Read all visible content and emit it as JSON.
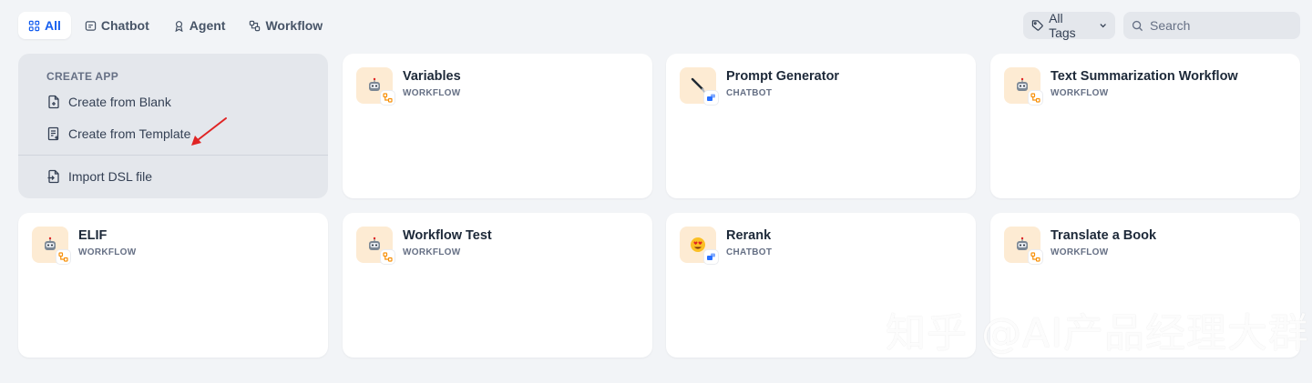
{
  "tabs": [
    {
      "label": "All",
      "icon": "grid-icon",
      "active": true
    },
    {
      "label": "Chatbot",
      "icon": "chat-icon",
      "active": false
    },
    {
      "label": "Agent",
      "icon": "agent-icon",
      "active": false
    },
    {
      "label": "Workflow",
      "icon": "workflow-icon",
      "active": false
    }
  ],
  "tags": {
    "label": "All Tags",
    "icon": "tag-icon"
  },
  "search": {
    "placeholder": "Search",
    "icon": "search-icon"
  },
  "create": {
    "title": "CREATE APP",
    "blank": "Create from Blank",
    "template": "Create from Template",
    "import": "Import DSL file"
  },
  "apps": [
    {
      "name": "Variables",
      "type": "WORKFLOW",
      "emoji": "robot"
    },
    {
      "name": "Prompt Generator",
      "type": "CHATBOT",
      "emoji": "pen"
    },
    {
      "name": "Text Summarization Workflow",
      "type": "WORKFLOW",
      "emoji": "robot"
    },
    {
      "name": "ELIF",
      "type": "WORKFLOW",
      "emoji": "robot"
    },
    {
      "name": "Workflow Test",
      "type": "WORKFLOW",
      "emoji": "robot"
    },
    {
      "name": "Rerank",
      "type": "CHATBOT",
      "emoji": "heart-eyes"
    },
    {
      "name": "Translate a Book",
      "type": "WORKFLOW",
      "emoji": "robot"
    }
  ],
  "watermark": "知乎 @AI产品经理大群",
  "colors": {
    "accent": "#155eef",
    "icon_bg": "#fdebd3",
    "workflow_badge": "#f79009",
    "chatbot_badge": "#2970ff",
    "annotation_arrow": "#e02424"
  }
}
